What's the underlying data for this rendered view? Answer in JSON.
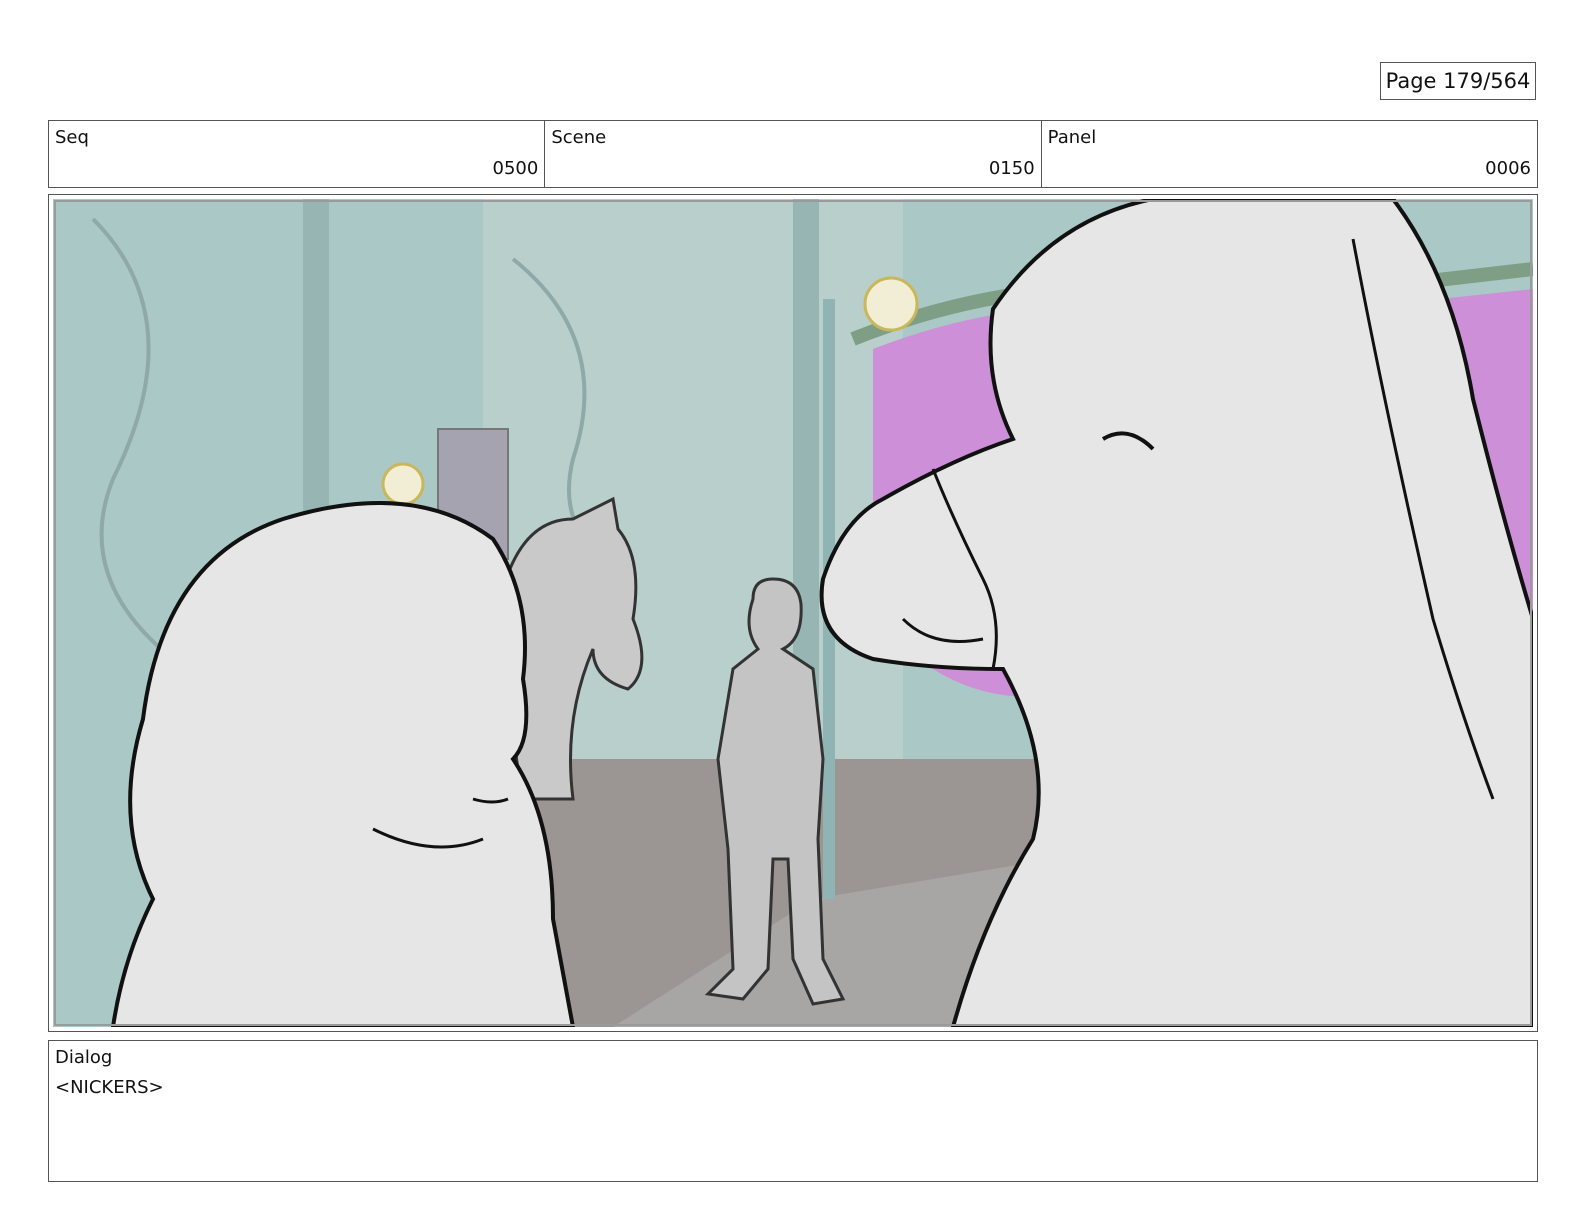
{
  "page": {
    "label": "Page 179/564"
  },
  "header": {
    "seq": {
      "label": "Seq",
      "value": "0500"
    },
    "scene": {
      "label": "Scene",
      "value": "0150"
    },
    "panel": {
      "label": "Panel",
      "value": "0006"
    }
  },
  "artwork": {
    "subject": "storyboard-sketch",
    "colors": {
      "wall": "#a9c8c6",
      "pink_panel": "#cc8fd8",
      "floor": "#9b9593",
      "sketch_fill": "#e6e6e6",
      "line": "#111111"
    }
  },
  "dialog": {
    "label": "Dialog",
    "text": "<NICKERS>"
  }
}
